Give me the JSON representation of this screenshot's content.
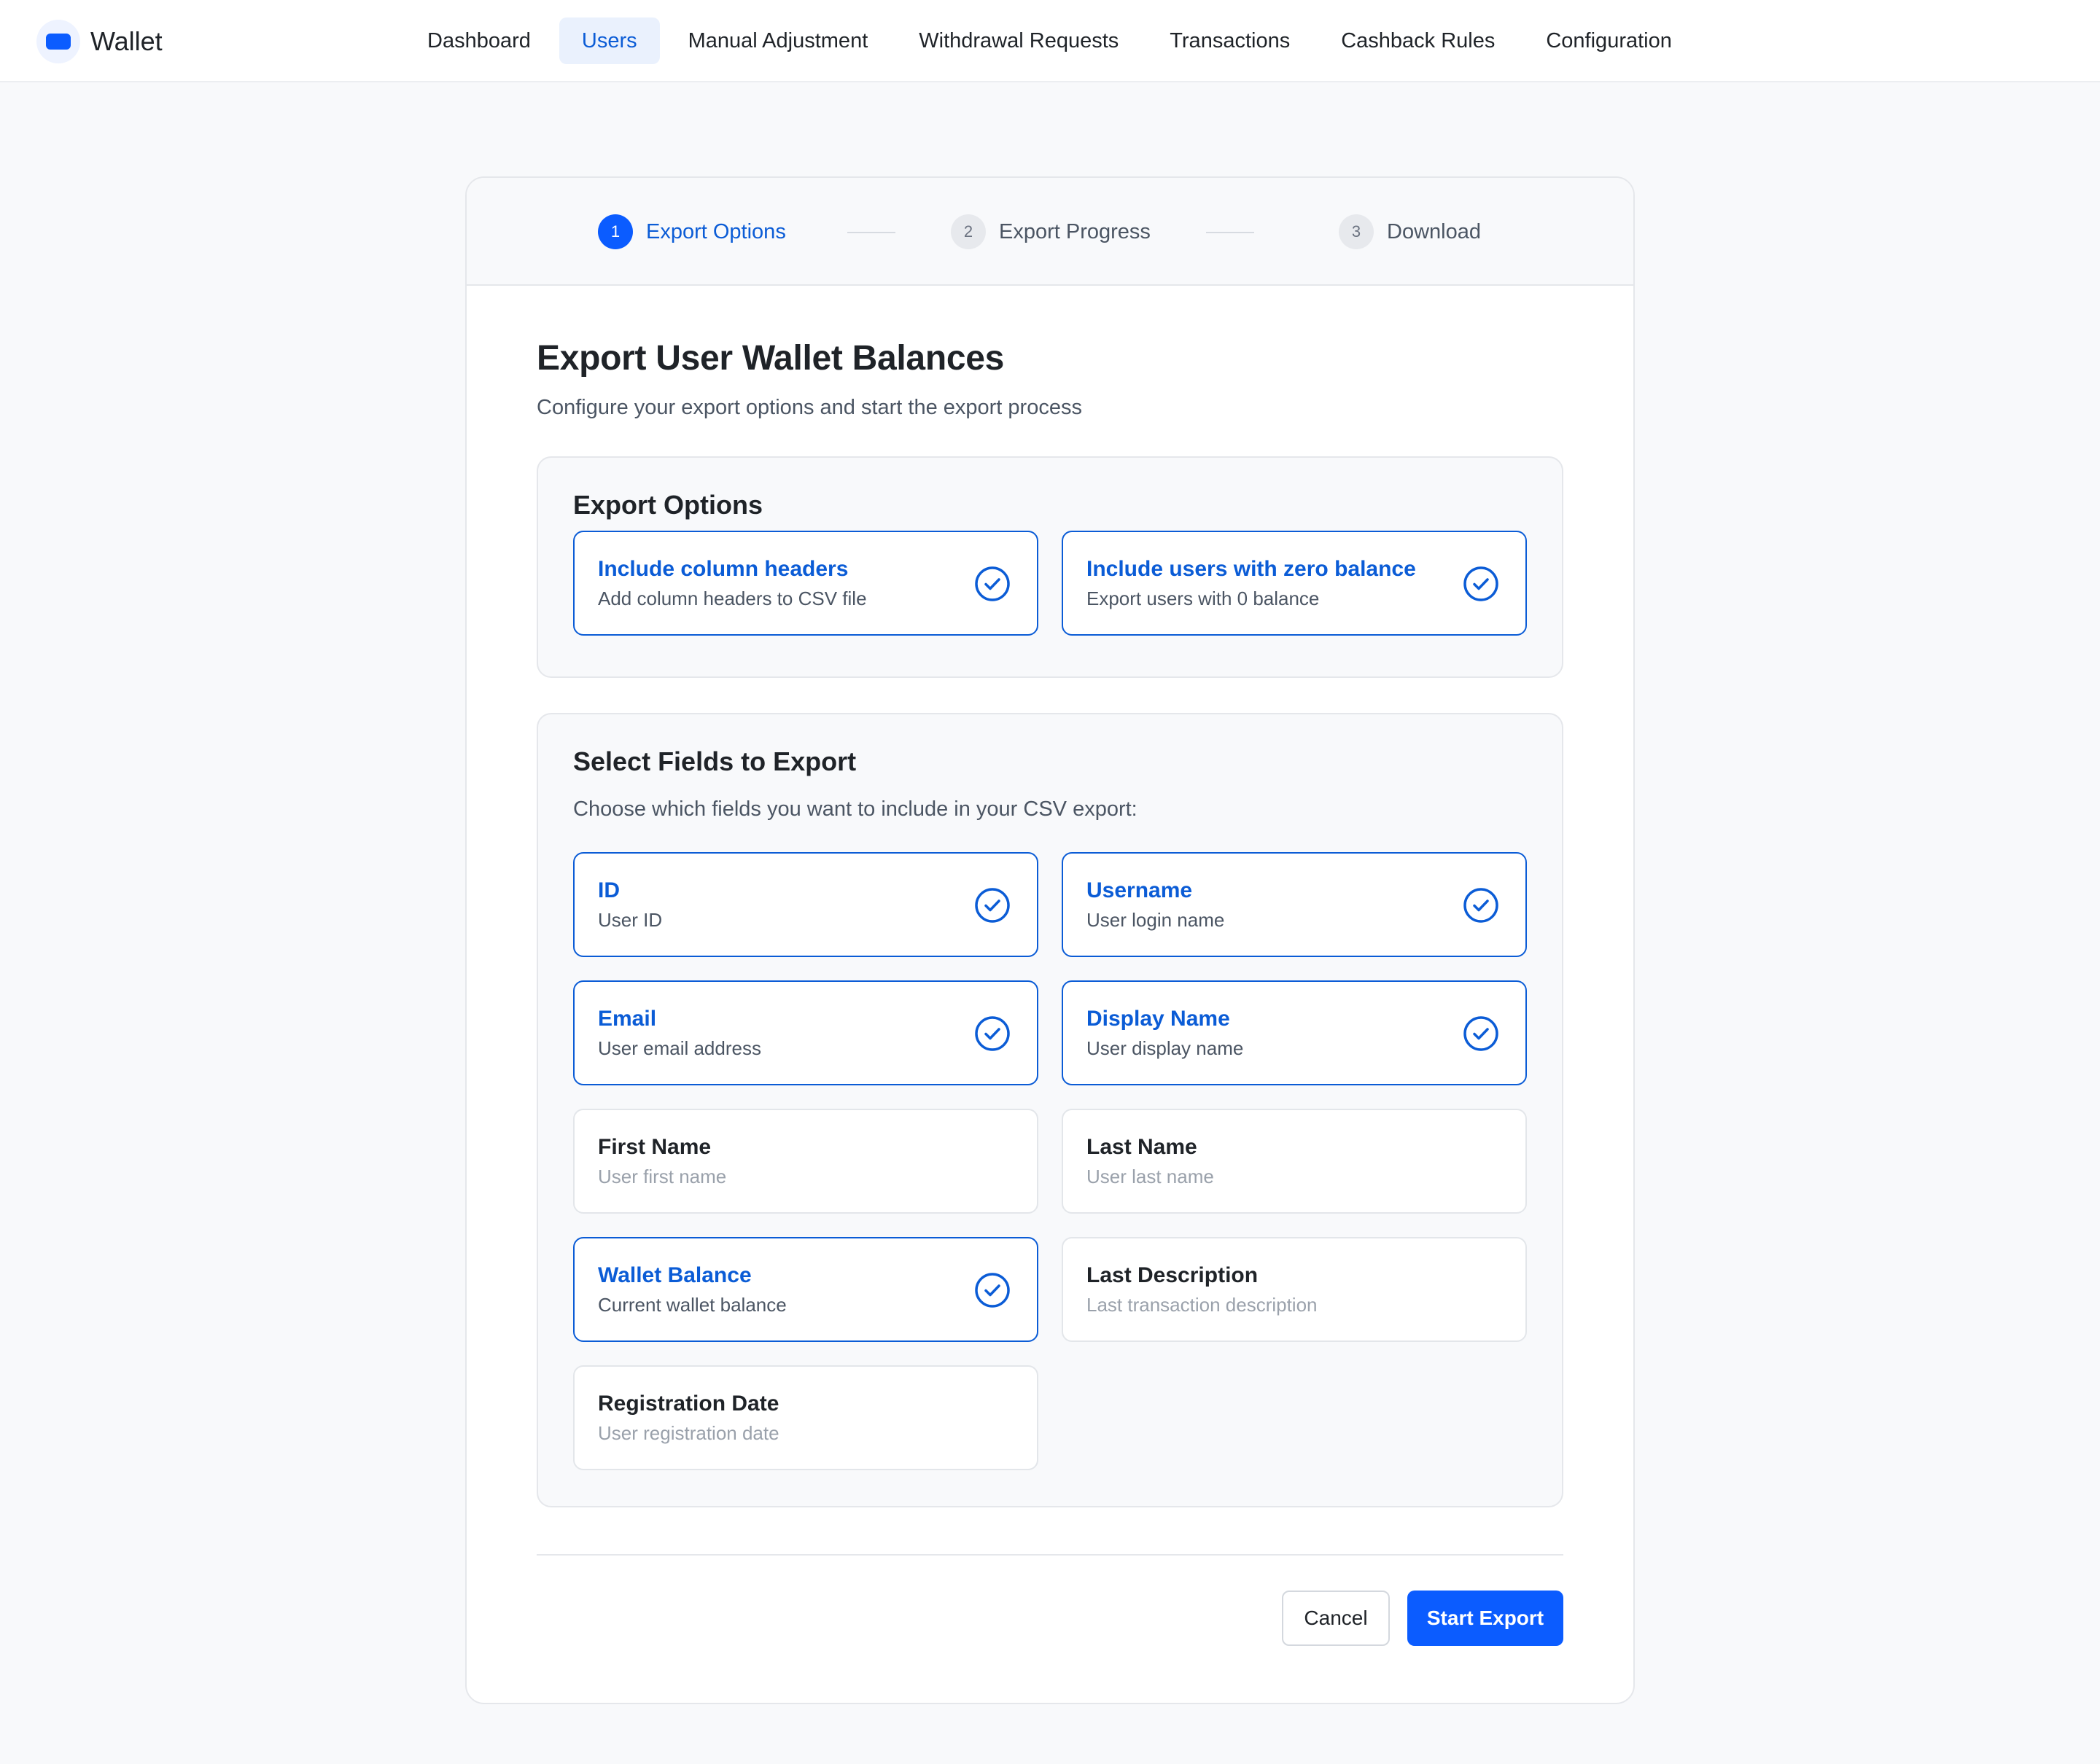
{
  "app": {
    "name": "Wallet"
  },
  "nav": {
    "items": [
      {
        "label": "Dashboard",
        "active": false
      },
      {
        "label": "Users",
        "active": true
      },
      {
        "label": "Manual Adjustment",
        "active": false
      },
      {
        "label": "Withdrawal Requests",
        "active": false
      },
      {
        "label": "Transactions",
        "active": false
      },
      {
        "label": "Cashback Rules",
        "active": false
      },
      {
        "label": "Configuration",
        "active": false
      }
    ]
  },
  "stepper": {
    "steps": [
      {
        "number": "1",
        "label": "Export Options",
        "active": true
      },
      {
        "number": "2",
        "label": "Export Progress",
        "active": false
      },
      {
        "number": "3",
        "label": "Download",
        "active": false
      }
    ]
  },
  "page": {
    "title": "Export User Wallet Balances",
    "subtitle": "Configure your export options and start the export process"
  },
  "export_options": {
    "title": "Export Options",
    "options": [
      {
        "title": "Include column headers",
        "desc": "Add column headers to CSV file",
        "checked": true
      },
      {
        "title": "Include users with zero balance",
        "desc": "Export users with 0 balance",
        "checked": true
      }
    ]
  },
  "fields": {
    "title": "Select Fields to Export",
    "description": "Choose which fields you want to include in your CSV export:",
    "items": [
      {
        "title": "ID",
        "desc": "User ID",
        "checked": true
      },
      {
        "title": "Username",
        "desc": "User login name",
        "checked": true
      },
      {
        "title": "Email",
        "desc": "User email address",
        "checked": true
      },
      {
        "title": "Display Name",
        "desc": "User display name",
        "checked": true
      },
      {
        "title": "First Name",
        "desc": "User first name",
        "checked": false
      },
      {
        "title": "Last Name",
        "desc": "User last name",
        "checked": false
      },
      {
        "title": "Wallet Balance",
        "desc": "Current wallet balance",
        "checked": true
      },
      {
        "title": "Last Description",
        "desc": "Last transaction description",
        "checked": false
      },
      {
        "title": "Registration Date",
        "desc": "User registration date",
        "checked": false
      }
    ]
  },
  "actions": {
    "cancel": "Cancel",
    "start": "Start Export"
  },
  "colors": {
    "accent": "#0b5cff",
    "accent_text": "#0b5cd6",
    "background": "#f8f9fb"
  },
  "icons": {
    "check": "check-circle-icon",
    "logo": "wallet-icon"
  }
}
